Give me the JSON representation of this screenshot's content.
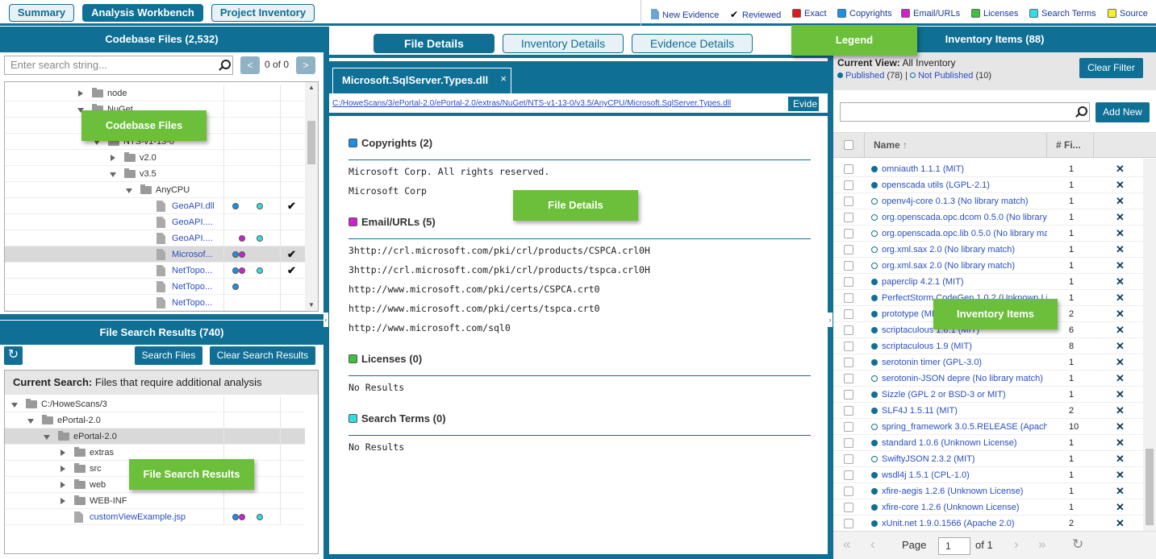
{
  "top_tabs": [
    {
      "label": "Summary",
      "active": false
    },
    {
      "label": "Analysis Workbench",
      "active": true
    },
    {
      "label": "Project Inventory",
      "active": false
    }
  ],
  "legend_strip": {
    "new_evidence": "New Evidence",
    "reviewed": "Reviewed",
    "exact": "Exact",
    "copyrights": "Copyrights",
    "email_urls": "Email/URLs",
    "licenses": "Licenses",
    "search_terms": "Search Terms",
    "source": "Source"
  },
  "colors": {
    "brand": "#0f6f95",
    "exact": "#e0191b",
    "copyrights": "#1a8fe8",
    "email_urls": "#d21fd2",
    "licenses": "#3cc23c",
    "search_terms": "#2fdfe6",
    "source": "#f5f028",
    "callout": "#6cbf3a",
    "link": "#2a4ec2"
  },
  "codebase": {
    "title": "Codebase Files (2,532)",
    "search_placeholder": "Enter search string...",
    "prev": "<",
    "next": ">",
    "count": "0 of 0",
    "tree": [
      {
        "label": "node",
        "type": "folder",
        "level": 4,
        "expand": "right",
        "link": false,
        "dots": [],
        "check": false,
        "sel": false
      },
      {
        "label": "NuGet",
        "type": "folder",
        "level": 4,
        "expand": "down",
        "link": false,
        "dots": [],
        "check": false,
        "sel": false
      },
      {
        "label": "",
        "type": "hidden",
        "level": 5,
        "expand": "",
        "link": false,
        "dots": [],
        "check": false,
        "sel": false
      },
      {
        "label": "NTS-v1-13-0",
        "type": "folder",
        "level": 5,
        "expand": "down",
        "link": false,
        "dots": [],
        "check": false,
        "sel": false
      },
      {
        "label": "v2.0",
        "type": "folder",
        "level": 6,
        "expand": "right",
        "link": false,
        "dots": [],
        "check": false,
        "sel": false
      },
      {
        "label": "v3.5",
        "type": "folder",
        "level": 6,
        "expand": "down",
        "link": false,
        "dots": [],
        "check": false,
        "sel": false
      },
      {
        "label": "AnyCPU",
        "type": "folder",
        "level": 7,
        "expand": "down",
        "link": false,
        "dots": [],
        "check": false,
        "sel": false
      },
      {
        "label": "GeoAPI.dll",
        "type": "file",
        "level": 8,
        "expand": "",
        "link": true,
        "dots": [
          "copyrights",
          "search_terms"
        ],
        "check": true,
        "sel": false
      },
      {
        "label": "GeoAPI....",
        "type": "file",
        "level": 8,
        "expand": "",
        "link": true,
        "dots": [],
        "check": false,
        "sel": false
      },
      {
        "label": "GeoAPI....",
        "type": "file",
        "level": 8,
        "expand": "",
        "link": true,
        "dots": [
          "email_urls",
          "search_terms"
        ],
        "check": false,
        "sel": false
      },
      {
        "label": "Microsof...",
        "type": "file",
        "level": 8,
        "expand": "",
        "link": true,
        "dots": [
          "copyrights",
          "email_urls"
        ],
        "check": true,
        "sel": true
      },
      {
        "label": "NetTopo...",
        "type": "file",
        "level": 8,
        "expand": "",
        "link": true,
        "dots": [
          "copyrights",
          "email_urls",
          "search_terms"
        ],
        "check": true,
        "sel": false
      },
      {
        "label": "NetTopo...",
        "type": "file",
        "level": 8,
        "expand": "",
        "link": true,
        "dots": [
          "copyrights"
        ],
        "check": false,
        "sel": false
      },
      {
        "label": "NetTopo...",
        "type": "file",
        "level": 8,
        "expand": "",
        "link": true,
        "dots": [],
        "check": false,
        "sel": false
      }
    ]
  },
  "search_results": {
    "title": "File Search Results (740)",
    "search_files": "Search Files",
    "clear": "Clear Search Results",
    "current_label": "Current Search:",
    "current_value": "Files that require additional analysis",
    "tree": [
      {
        "label": "C:/HoweScans/3",
        "type": "folder",
        "level": 0,
        "expand": "down",
        "link": false,
        "dots": [],
        "sel": false
      },
      {
        "label": "ePortal-2.0",
        "type": "folder",
        "level": 1,
        "expand": "down",
        "link": false,
        "dots": [],
        "sel": false
      },
      {
        "label": "ePortal-2.0",
        "type": "folder",
        "level": 2,
        "expand": "down",
        "link": false,
        "dots": [],
        "sel": true
      },
      {
        "label": "extras",
        "type": "folder",
        "level": 3,
        "expand": "right",
        "link": false,
        "dots": [],
        "sel": false
      },
      {
        "label": "src",
        "type": "folder",
        "level": 3,
        "expand": "right",
        "link": false,
        "dots": [],
        "sel": false
      },
      {
        "label": "web",
        "type": "folder",
        "level": 3,
        "expand": "right",
        "link": false,
        "dots": [],
        "sel": false
      },
      {
        "label": "WEB-INF",
        "type": "folder",
        "level": 3,
        "expand": "right",
        "link": false,
        "dots": [],
        "sel": false
      },
      {
        "label": "customViewExample.jsp",
        "type": "file",
        "level": 3,
        "expand": "",
        "link": true,
        "dots": [
          "copyrights",
          "email_urls",
          "search_terms"
        ],
        "sel": false
      }
    ]
  },
  "center": {
    "tabs": [
      {
        "label": "File Details",
        "active": true
      },
      {
        "label": "Inventory Details",
        "active": false
      },
      {
        "label": "Evidence Details",
        "active": false
      }
    ],
    "file_tab": "Microsoft.SqlServer.Types.dll",
    "file_tab_close": "×",
    "path": "C:/HoweScans/3/ePortal-2.0/ePortal-2.0/extras/NuGet/NTS-v1-13-0/v3.5/AnyCPU/Microsoft.SqlServer.Types.dll",
    "evidence_btn": "Evide",
    "sections": [
      {
        "title": "Copyrights (2)",
        "color": "copyrights",
        "lines": [
          "Microsoft Corp. All rights reserved.",
          "Microsoft Corp"
        ]
      },
      {
        "title": "Email/URLs (5)",
        "color": "email_urls",
        "lines": [
          "3http://crl.microsoft.com/pki/crl/products/CSPCA.crl0H",
          "3http://crl.microsoft.com/pki/crl/products/tspca.crl0H",
          "http://www.microsoft.com/pki/certs/CSPCA.crt0",
          "http://www.microsoft.com/pki/certs/tspca.crt0",
          "http://www.microsoft.com/sql0"
        ]
      },
      {
        "title": "Licenses (0)",
        "color": "licenses",
        "lines": [
          "No Results"
        ]
      },
      {
        "title": "Search Terms (0)",
        "color": "search_terms",
        "lines": [
          "No Results"
        ]
      }
    ]
  },
  "inventory": {
    "title": "Inventory Items (88)",
    "current_view_label": "Current View:",
    "current_view_value": "All Inventory",
    "published": "Published",
    "published_count": "(78)",
    "separator": "|",
    "not_published": "Not Published",
    "not_published_count": "(10)",
    "clear_filter": "Clear Filter",
    "add_new": "Add New",
    "col_name": "Name",
    "sort_arrow": "↑",
    "col_files": "# Fi...",
    "rows": [
      {
        "name": "omniauth 1.1.1 (MIT)",
        "count": "1",
        "published": true
      },
      {
        "name": "openscada utils (LGPL-2.1)",
        "count": "1",
        "published": true
      },
      {
        "name": "openv4j-core 0.1.3 (No library match)",
        "count": "1",
        "published": false
      },
      {
        "name": "org.openscada.opc.dcom 0.5.0 (No library",
        "count": "1",
        "published": false
      },
      {
        "name": "org.openscada.opc.lib 0.5.0 (No library ma",
        "count": "1",
        "published": false
      },
      {
        "name": "org.xml.sax 2.0 (No library match)",
        "count": "1",
        "published": false
      },
      {
        "name": "org.xml.sax 2.0 (No library match)",
        "count": "1",
        "published": false
      },
      {
        "name": "paperclip 4.2.1 (MIT)",
        "count": "1",
        "published": true
      },
      {
        "name": "PerfectStorm CodeGen 1.0.2 (Unknown Li",
        "count": "1",
        "published": true
      },
      {
        "name": "prototype (MIT)",
        "count": "2",
        "published": true
      },
      {
        "name": "scriptaculous 1.8.1 (MIT)",
        "count": "6",
        "published": true
      },
      {
        "name": "scriptaculous 1.9 (MIT)",
        "count": "8",
        "published": true
      },
      {
        "name": "serotonin timer (GPL-3.0)",
        "count": "1",
        "published": true
      },
      {
        "name": "serotonin-JSON depre (No library match)",
        "count": "1",
        "published": false
      },
      {
        "name": "Sizzle (GPL 2 or BSD-3 or MIT)",
        "count": "1",
        "published": true
      },
      {
        "name": "SLF4J 1.5.11 (MIT)",
        "count": "2",
        "published": true
      },
      {
        "name": "spring_framework 3.0.5.RELEASE (Apach",
        "count": "10",
        "published": false
      },
      {
        "name": "standard 1.0.6 (Unknown License)",
        "count": "1",
        "published": true
      },
      {
        "name": "SwiftyJSON 2.3.2 (MIT)",
        "count": "1",
        "published": false
      },
      {
        "name": "wsdl4j 1.5.1 (CPL-1.0)",
        "count": "1",
        "published": true
      },
      {
        "name": "xfire-aegis 1.2.6 (Unknown License)",
        "count": "1",
        "published": true
      },
      {
        "name": "xfire-core 1.2.6 (Unknown License)",
        "count": "1",
        "published": true
      },
      {
        "name": "xUnit.net 1.9.0.1566 (Apache 2.0)",
        "count": "2",
        "published": true
      }
    ],
    "pager": {
      "first": "«",
      "prev": "‹",
      "page_label": "Page",
      "page": "1",
      "of": "of 1",
      "next": "›",
      "last": "»",
      "refresh": "↻"
    }
  },
  "callouts": {
    "legend": "Legend",
    "codebase": "Codebase Files",
    "file_details": "File Details",
    "inventory": "Inventory Items",
    "search_results": "File Search Results"
  }
}
